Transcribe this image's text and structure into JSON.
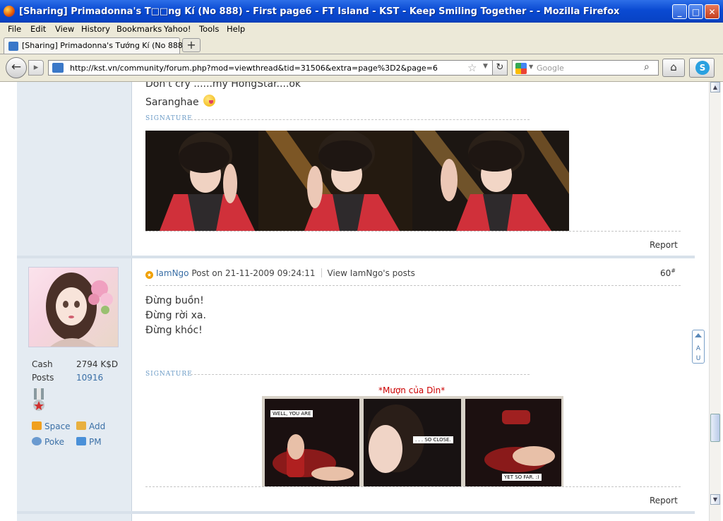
{
  "window": {
    "title": "[Sharing] Primadonna's T□□ng Kí (No 888) - First page6 - FT Island - KST - Keep Smiling Together - - Mozilla Firefox",
    "min": "_",
    "max": "□",
    "close": "✕"
  },
  "menu": [
    "File",
    "Edit",
    "View",
    "History",
    "Bookmarks",
    "Yahoo!",
    "Tools",
    "Help"
  ],
  "tab": {
    "label": "[Sharing] Primadonna's Tướng Kí (No 888) - ...",
    "new_tab": "+"
  },
  "nav": {
    "back": "←",
    "forward": "▸",
    "url": "http://kst.vn/community/forum.php?mod=viewthread&tid=31506&extra=page%3D2&page=6",
    "star": "☆",
    "dropdown": "▼",
    "reload": "↻",
    "search_placeholder": "Google",
    "search_dd": "▼",
    "search_glass": "⌕",
    "home": "⌂",
    "skype": "S"
  },
  "post1": {
    "line1": "Don't cry ......my HongStar....ok",
    "line2": "Saranghae",
    "signature_label": "SIGNATURE",
    "report": "Report"
  },
  "post2": {
    "author": "IamNgo",
    "posted": "Post on 21-11-2009 09:24:11",
    "view_posts": "View IamNgo's posts",
    "floor": "60",
    "floor_sup": "#",
    "lines": [
      "Đừng buồn!",
      "Đừng rời xa.",
      "Đừng khóc!"
    ],
    "signature_label": "SIGNATURE",
    "caption": "*Mượn của Dìn*",
    "report": "Report",
    "comic_texts": [
      "WELL, YOU ARE",
      ". . . SO CLOSE.",
      "YET SO FAR. :)"
    ]
  },
  "user": {
    "cash_label": "Cash",
    "cash_value": "2794 K$D",
    "posts_label": "Posts",
    "posts_value": "10916",
    "actions": [
      "Space",
      "Add",
      "Poke",
      "PM"
    ]
  },
  "scroll": {
    "up": "▲",
    "down": "▼"
  }
}
